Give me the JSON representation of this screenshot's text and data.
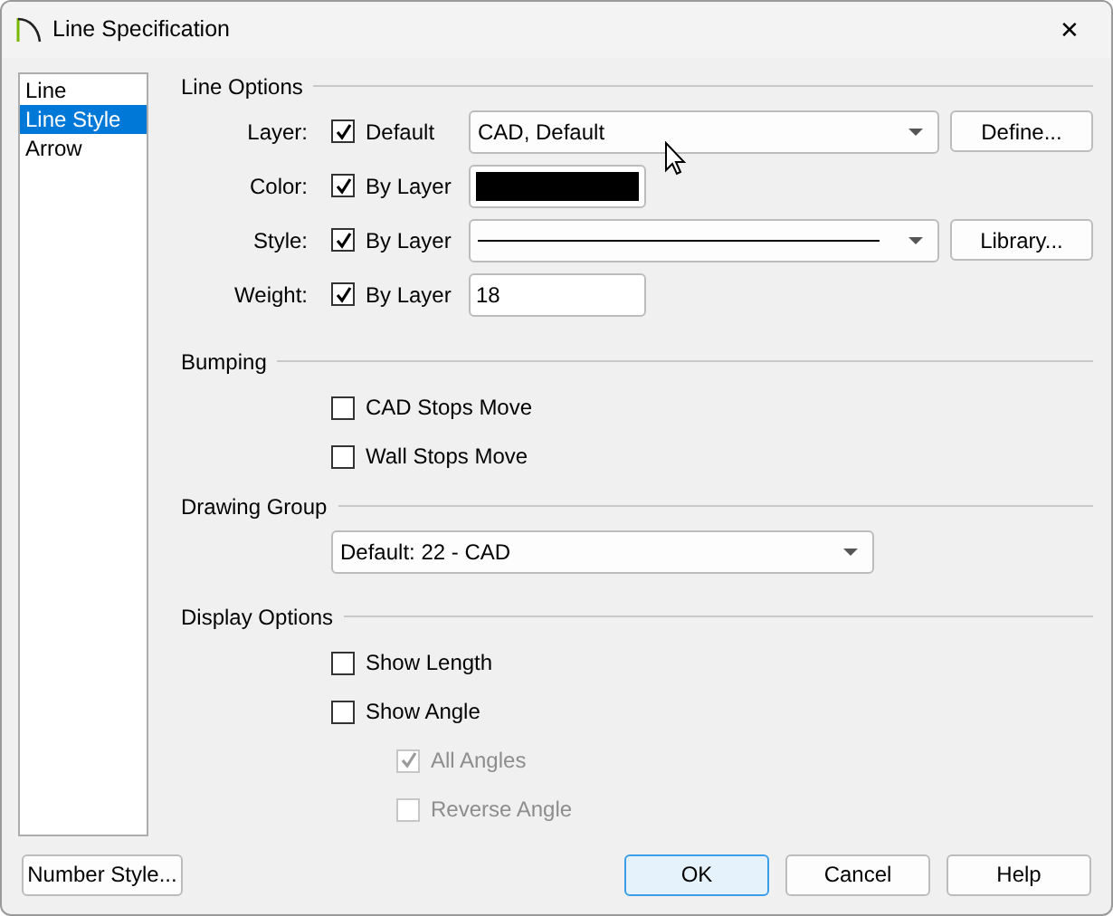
{
  "window": {
    "title": "Line Specification",
    "close": "✕"
  },
  "sidebar": {
    "items": [
      {
        "label": "Line",
        "selected": false
      },
      {
        "label": "Line Style",
        "selected": true
      },
      {
        "label": "Arrow",
        "selected": false
      }
    ]
  },
  "line_options": {
    "title": "Line Options",
    "rows": [
      {
        "kind": "dropdown",
        "label": "Layer:",
        "check_label": "Default",
        "checked": true,
        "value": "CAD,  Default",
        "button": "Define..."
      },
      {
        "kind": "color",
        "label": "Color:",
        "check_label": "By Layer",
        "checked": true,
        "color": "#000000"
      },
      {
        "kind": "line-style",
        "label": "Style:",
        "check_label": "By Layer",
        "checked": true,
        "button": "Library..."
      },
      {
        "kind": "text",
        "label": "Weight:",
        "check_label": "By Layer",
        "checked": true,
        "value": "18"
      }
    ]
  },
  "bumping": {
    "title": "Bumping",
    "options": [
      {
        "label": "CAD Stops Move",
        "checked": false,
        "disabled": false
      },
      {
        "label": "Wall Stops Move",
        "checked": false,
        "disabled": false
      }
    ]
  },
  "drawing_group": {
    "title": "Drawing Group",
    "value": "Default: 22 - CAD"
  },
  "display_options": {
    "title": "Display Options",
    "options": [
      {
        "label": "Show Length",
        "checked": false,
        "disabled": false
      },
      {
        "label": "Show Angle",
        "checked": false,
        "disabled": false,
        "children": [
          {
            "label": "All Angles",
            "checked": true,
            "disabled": true
          },
          {
            "label": "Reverse Angle",
            "checked": false,
            "disabled": true
          }
        ]
      }
    ]
  },
  "buttons": [
    {
      "label": "Number Style...",
      "kind": "left",
      "default": false
    },
    {
      "label": "OK",
      "kind": "right",
      "default": true
    },
    {
      "label": "Cancel",
      "kind": "right",
      "default": false
    },
    {
      "label": "Help",
      "kind": "right",
      "default": false
    }
  ]
}
